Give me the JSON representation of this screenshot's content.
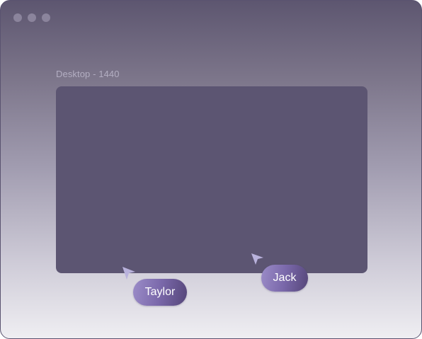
{
  "window": {
    "frame_label": "Desktop - 1440"
  },
  "collaborators": [
    {
      "name": "Taylor",
      "cursor_icon": "cursor-arrow-icon"
    },
    {
      "name": "Jack",
      "cursor_icon": "cursor-arrow-icon"
    }
  ],
  "colors": {
    "frame_fill": "#5c5572",
    "pill_start": "#9b8cc8",
    "pill_end": "#554679",
    "cursor": "#b9b2dc"
  }
}
